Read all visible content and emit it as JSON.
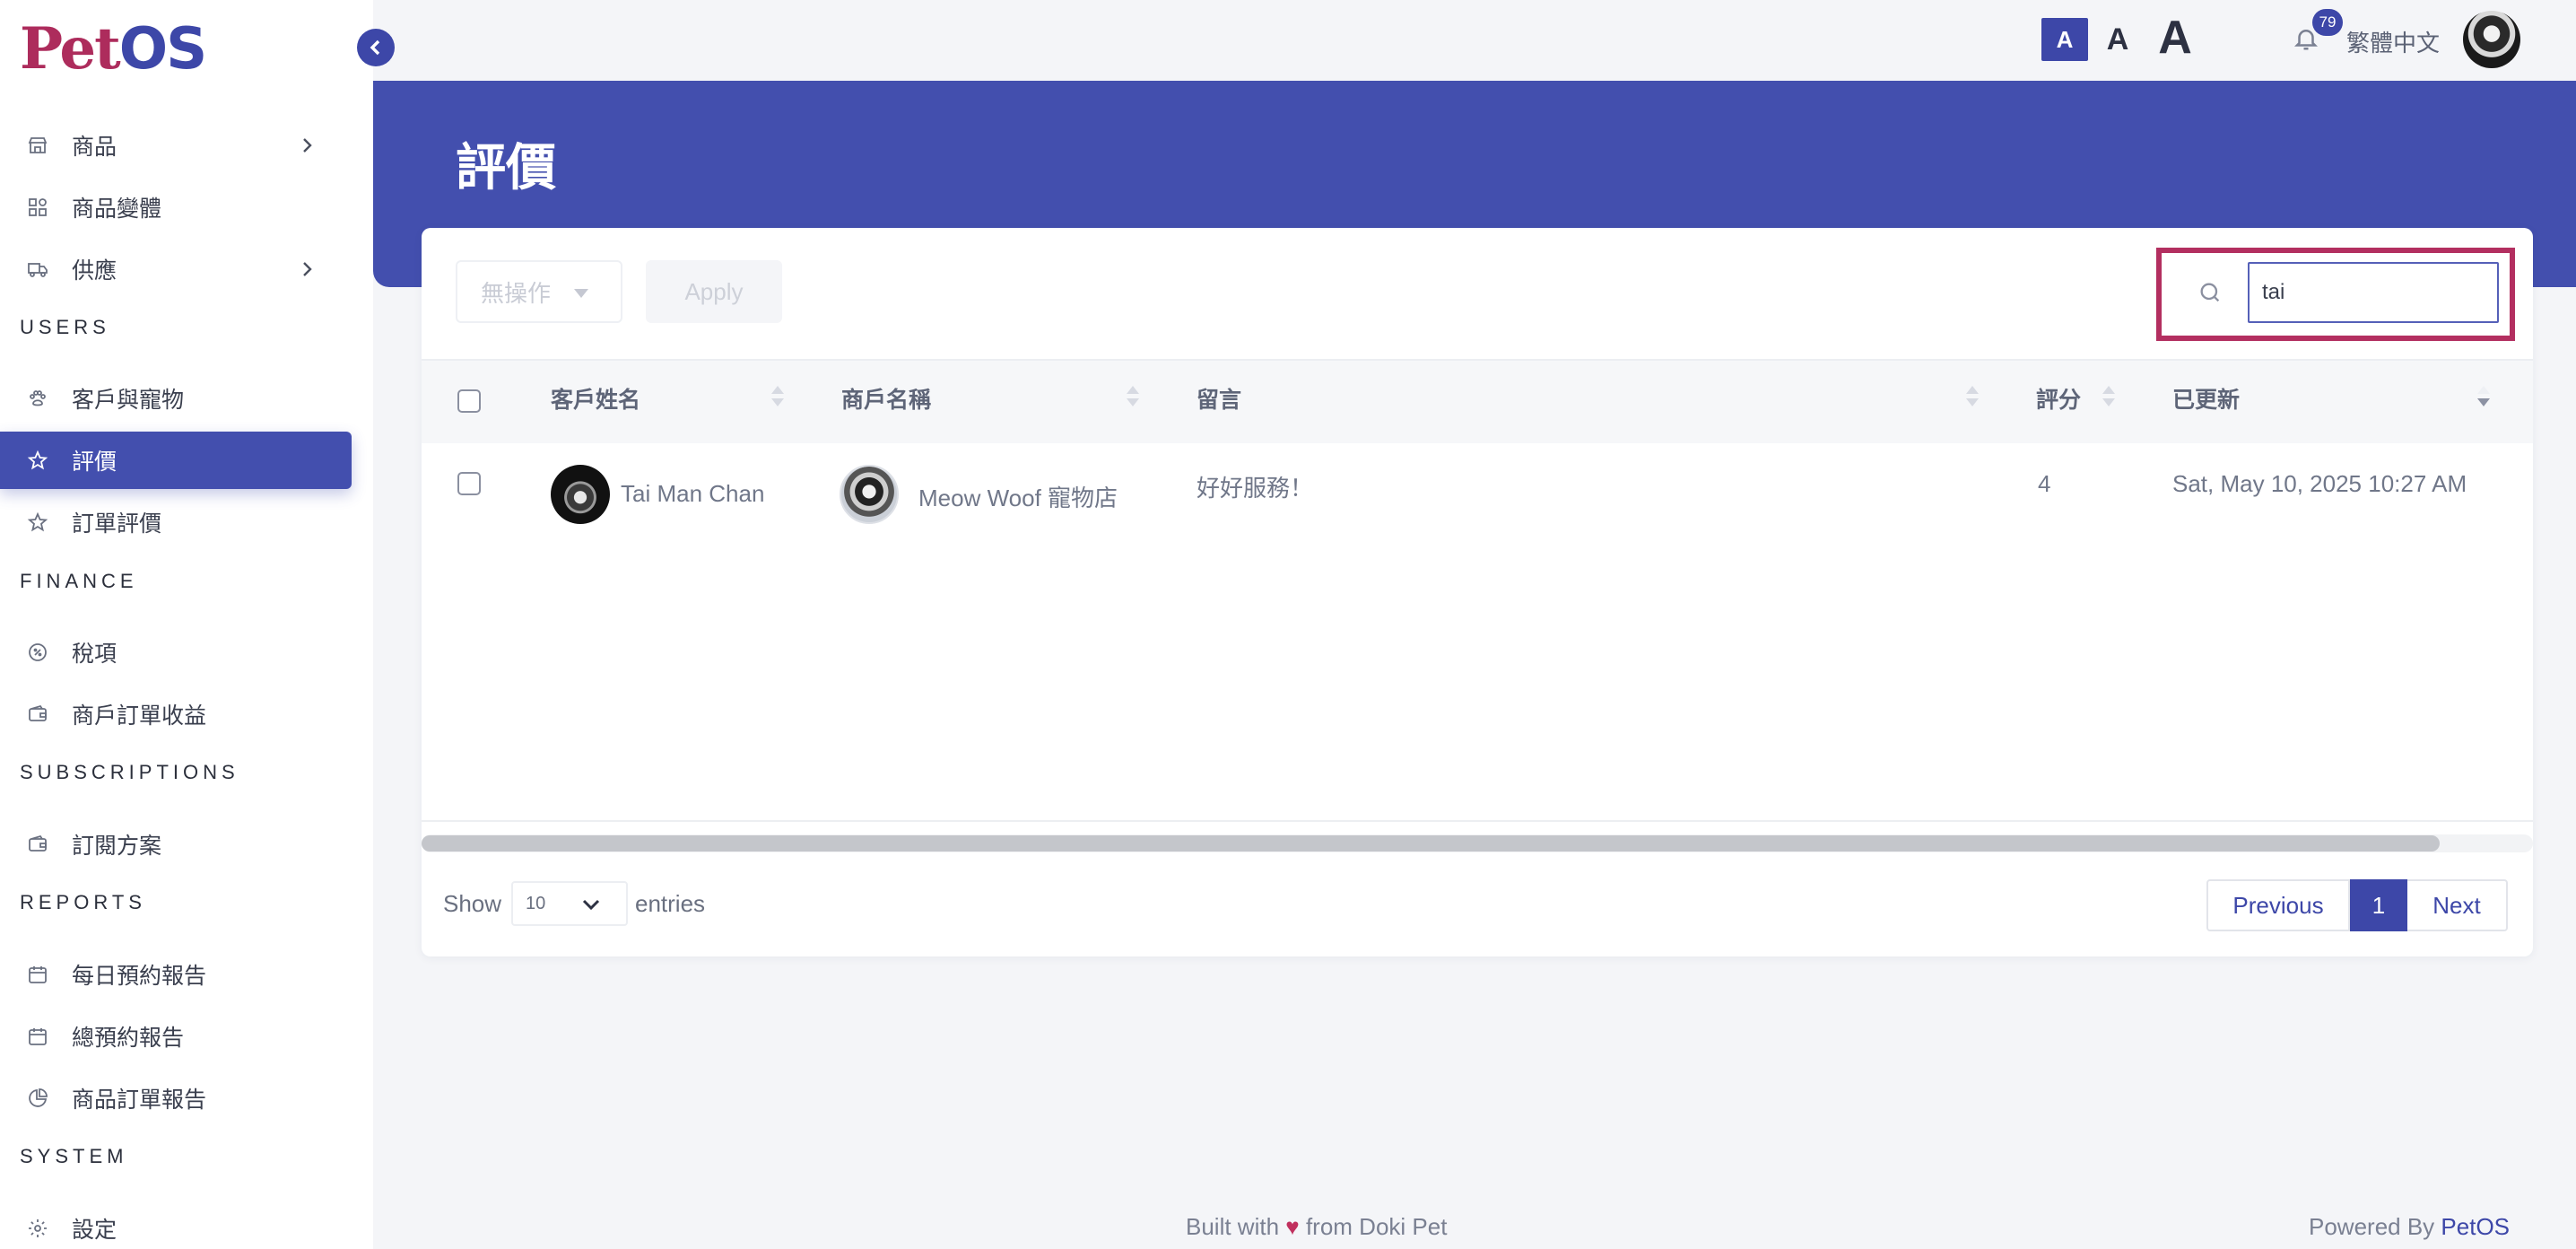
{
  "brand": {
    "logo_pet": "Pet",
    "logo_os": "OS"
  },
  "topbar": {
    "font_small": "A",
    "font_mid": "A",
    "font_big": "A",
    "notification_count": "79",
    "language": "繁體中文"
  },
  "sidebar": {
    "items": [
      {
        "label": "商品",
        "icon": "store-icon",
        "has_submenu": true
      },
      {
        "label": "商品變體",
        "icon": "variants-icon",
        "has_submenu": false
      },
      {
        "label": "供應",
        "icon": "truck-icon",
        "has_submenu": true
      }
    ],
    "sections": [
      {
        "title": "USERS",
        "items": [
          {
            "label": "客戶與寵物",
            "icon": "paw-icon"
          },
          {
            "label": "評價",
            "icon": "star-icon",
            "active": true
          },
          {
            "label": "訂單評價",
            "icon": "star-icon"
          }
        ]
      },
      {
        "title": "FINANCE",
        "items": [
          {
            "label": "稅項",
            "icon": "tax-icon"
          },
          {
            "label": "商戶訂單收益",
            "icon": "wallet-icon"
          }
        ]
      },
      {
        "title": "SUBSCRIPTIONS",
        "items": [
          {
            "label": "訂閱方案",
            "icon": "wallet-icon"
          }
        ]
      },
      {
        "title": "REPORTS",
        "items": [
          {
            "label": "每日預約報告",
            "icon": "calendar-icon"
          },
          {
            "label": "總預約報告",
            "icon": "calendar-icon"
          },
          {
            "label": "商品訂單報告",
            "icon": "pie-chart-icon"
          }
        ]
      },
      {
        "title": "SYSTEM",
        "items": [
          {
            "label": "設定",
            "icon": "gear-icon"
          }
        ]
      }
    ]
  },
  "page": {
    "title": "評價"
  },
  "toolbar": {
    "bulk_action_value": "無操作",
    "apply_label": "Apply",
    "search_value": "tai"
  },
  "table": {
    "columns": [
      "客戶姓名",
      "商戶名稱",
      "留言",
      "評分",
      "已更新"
    ],
    "rows": [
      {
        "customer": "Tai Man Chan",
        "merchant": "Meow Woof 寵物店",
        "message": "好好服務！",
        "rating": "4",
        "updated": "Sat, May 10, 2025 10:27 AM"
      }
    ]
  },
  "pagination": {
    "show_label": "Show",
    "entries_value": "10",
    "entries_label": "entries",
    "previous_label": "Previous",
    "current_page": "1",
    "next_label": "Next"
  },
  "footer": {
    "built_prefix": "Built with",
    "heart": "♥",
    "built_suffix": "from Doki Pet",
    "powered_prefix": "Powered By",
    "powered_brand": "PetOS"
  },
  "colors": {
    "primary": "#434fae",
    "accent": "#b32f60",
    "logo_pet": "#ad2c5c"
  }
}
